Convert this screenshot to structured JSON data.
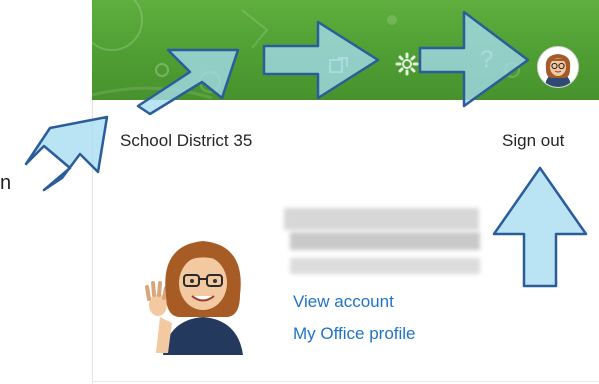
{
  "header": {
    "org_name": "School District 35",
    "sign_out_label": "Sign out",
    "icons": [
      "share-icon",
      "gear-icon",
      "help-icon"
    ],
    "help_glyph": "?"
  },
  "left_edge_text": "n",
  "account": {
    "links": {
      "view_account": "View account",
      "office_profile": "My Office profile"
    }
  },
  "colors": {
    "header_green": "#4f9e33",
    "link_blue": "#1f74c9",
    "arrow_fill": "#a7dcf0",
    "arrow_stroke": "#2a5d9a"
  }
}
